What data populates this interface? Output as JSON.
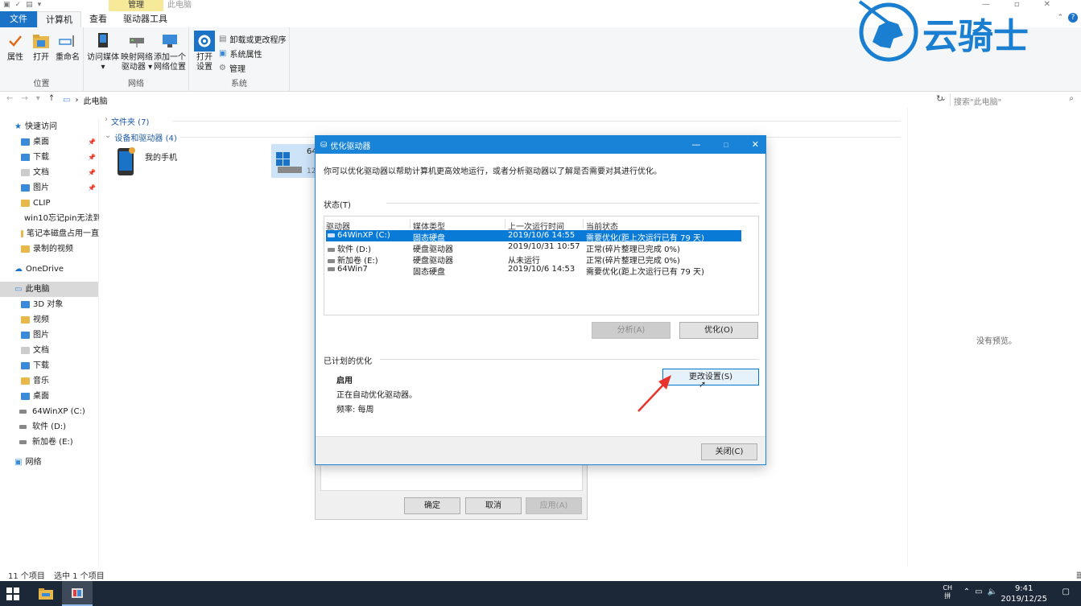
{
  "window": {
    "context_tab": "管理",
    "title": "此电脑",
    "tabs": [
      "文件",
      "计算机",
      "查看",
      "驱动器工具"
    ]
  },
  "ribbon": {
    "location_group": {
      "label": "位置",
      "buttons": [
        "属性",
        "打开",
        "重命名"
      ]
    },
    "network_group": {
      "label": "网络",
      "access_media": [
        "访问媒体",
        "▾"
      ],
      "map_drive": [
        "映射网络",
        "驱动器 ▾"
      ],
      "add_location": [
        "添加一个",
        "网络位置"
      ]
    },
    "system_group": {
      "label": "系统",
      "open_settings": [
        "打开",
        "设置"
      ],
      "small_buttons": [
        "卸载或更改程序",
        "系统属性",
        "管理"
      ]
    }
  },
  "address": {
    "path": "此电脑",
    "search_placeholder": "搜索\"此电脑\""
  },
  "nav": {
    "quick_access": "快速访问",
    "quick_items": [
      "桌面",
      "下载",
      "文档",
      "图片",
      "CLIP",
      "win10忘记pin无法到",
      "笔记本磁盘占用一直",
      "录制的视频"
    ],
    "onedrive": "OneDrive",
    "this_pc": "此电脑",
    "pc_items": [
      "3D 对象",
      "视频",
      "图片",
      "文档",
      "下载",
      "音乐",
      "桌面",
      "64WinXP  (C:)",
      "软件 (D:)",
      "新加卷 (E:)"
    ],
    "network": "网络"
  },
  "content": {
    "folders_header": "文件夹 (7)",
    "devices_header": "设备和驱动器 (4)",
    "my_phone": "我的手机",
    "peek_label": "64",
    "peek_sub": "12",
    "no_preview": "没有预览。"
  },
  "statusbar": {
    "items": "11 个项目",
    "selected": "选中 1 个项目"
  },
  "optimize_dialog": {
    "title": "优化驱动器",
    "description": "你可以优化驱动器以帮助计算机更高效地运行，或者分析驱动器以了解是否需要对其进行优化。",
    "status_label": "状态(T)",
    "columns": [
      "驱动器",
      "媒体类型",
      "上一次运行时间",
      "当前状态"
    ],
    "rows": [
      {
        "drive": "64WinXP  (C:)",
        "media": "固态硬盘",
        "last_run": "2019/10/6 14:55",
        "status": "需要优化(距上次运行已有 79 天)"
      },
      {
        "drive": "软件 (D:)",
        "media": "硬盘驱动器",
        "last_run": "2019/10/31 10:57",
        "status": "正常(碎片整理已完成 0%)"
      },
      {
        "drive": "新加卷 (E:)",
        "media": "硬盘驱动器",
        "last_run": "从未运行",
        "status": "正常(碎片整理已完成 0%)"
      },
      {
        "drive": "64Win7",
        "media": "固态硬盘",
        "last_run": "2019/10/6 14:53",
        "status": "需要优化(距上次运行已有 79 天)"
      }
    ],
    "analyze_button": "分析(A)",
    "optimize_button": "优化(O)",
    "scheduled_label": "已计划的优化",
    "schedule_status": "启用",
    "schedule_desc": "正在自动优化驱动器。",
    "schedule_freq": "频率: 每周",
    "change_settings_button": "更改设置(S)",
    "close_button": "关闭(C)"
  },
  "props_dialog": {
    "ok": "确定",
    "cancel": "取消",
    "apply": "应用(A)"
  },
  "taskbar": {
    "ime_top": "CH",
    "ime_bottom": "拼",
    "time": "9:41",
    "date": "2019/12/25"
  },
  "watermark": {
    "text": "云骑士"
  },
  "colors": {
    "accent": "#1883d7",
    "file_tab": "#1a73c6",
    "context_tab": "#f7e99a",
    "selection": "#0a7ad7",
    "taskbar": "#1c2838",
    "watermark": "#1a7fd0",
    "arrow": "#e8332a"
  }
}
